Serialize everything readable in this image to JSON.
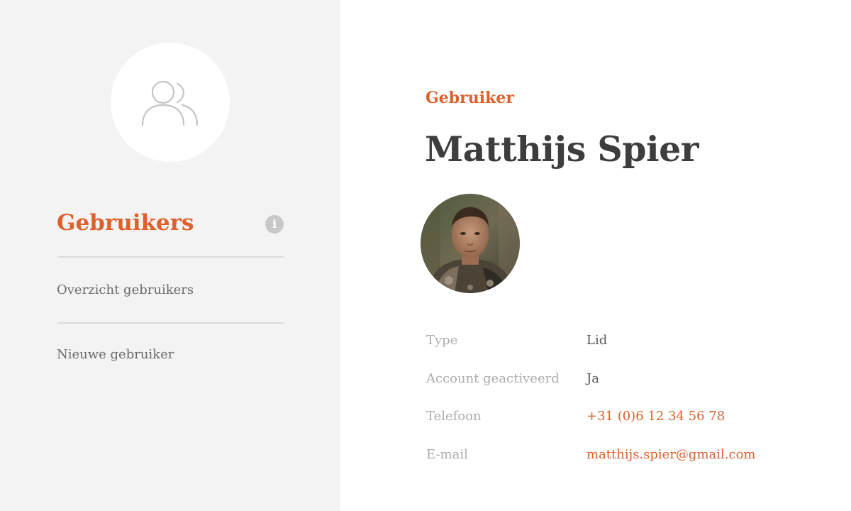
{
  "sidebar": {
    "section_icon": "users-icon",
    "heading": "Gebruikers",
    "info_icon_glyph": "i",
    "items": [
      {
        "label": "Overzicht gebruikers"
      },
      {
        "label": "Nieuwe gebruiker"
      }
    ]
  },
  "main": {
    "eyebrow": "Gebruiker",
    "name": "Matthijs Spier",
    "avatar": "user-photo",
    "details": [
      {
        "label": "Type",
        "value": "Lid",
        "is_link": false
      },
      {
        "label": "Account geactiveerd",
        "value": "Ja",
        "is_link": false
      },
      {
        "label": "Telefoon",
        "value": "+31 (0)6 12 34 56 78",
        "is_link": true
      },
      {
        "label": "E-mail",
        "value": "matthijs.spier@gmail.com",
        "is_link": true
      }
    ]
  },
  "colors": {
    "accent": "#e0602c",
    "sidebar_bg": "#f3f3f3",
    "heading_dark": "#3d3d3d",
    "label_gray": "#adadad",
    "divider": "#dcdcdc"
  }
}
